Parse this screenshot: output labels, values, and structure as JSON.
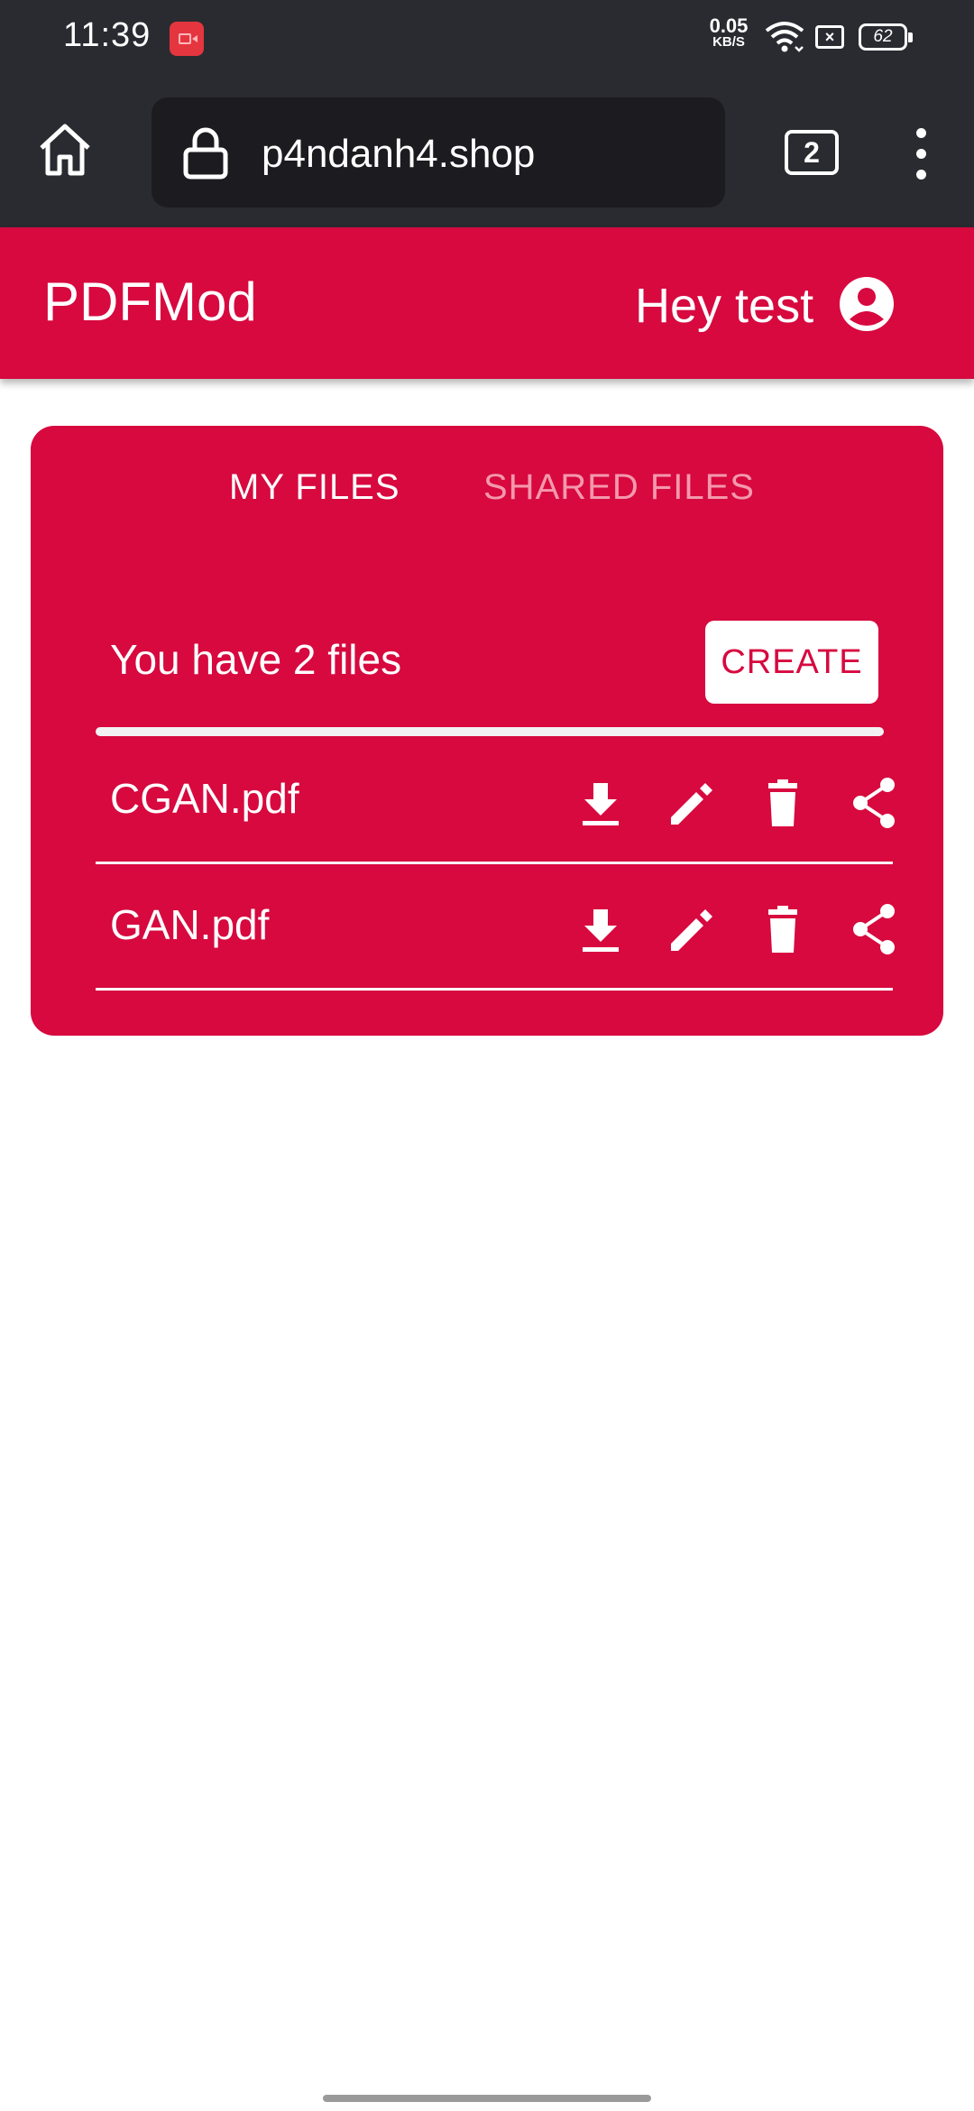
{
  "status_bar": {
    "time": "11:39",
    "net_speed_value": "0.05",
    "net_speed_unit": "KB/S",
    "battery": "62"
  },
  "browser": {
    "url": "p4ndanh4.shop",
    "tab_count": "2"
  },
  "app_bar": {
    "title": "PDFMod",
    "greeting": "Hey test"
  },
  "tabs": [
    {
      "label": "MY FILES",
      "active": true
    },
    {
      "label": "SHARED FILES",
      "active": false
    }
  ],
  "files": {
    "summary": "You have 2 files",
    "create_label": "CREATE",
    "items": [
      {
        "name": "CGAN.pdf"
      },
      {
        "name": "GAN.pdf"
      }
    ]
  },
  "colors": {
    "brand": "#d7093f",
    "browser_chrome": "#2a2b31",
    "inactive_tab": "#f398ad"
  },
  "icons": [
    "home-icon",
    "lock-icon",
    "tabs-icon",
    "more-vert-icon",
    "account-circle-icon",
    "download-icon",
    "edit-icon",
    "delete-icon",
    "share-icon"
  ]
}
